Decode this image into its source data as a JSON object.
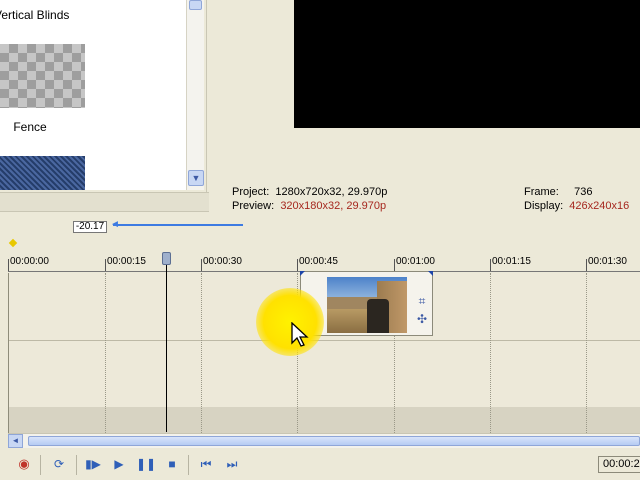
{
  "transitions": {
    "top_item_label": "Vertical Blinds",
    "fence_label": "Fence"
  },
  "preview_info": {
    "project_label": "Project:",
    "project_value": "1280x720x32, 29.970p",
    "preview_label": "Preview:",
    "preview_value": "320x180x32, 29.970p",
    "frame_label": "Frame:",
    "frame_value": "736",
    "display_label": "Display:",
    "display_value": "426x240x16"
  },
  "timeline": {
    "cursor_offset": "-20.17",
    "ruler": [
      "00:00:00",
      "00:00:15",
      "00:00:30",
      "00:00:45",
      "00:01:00",
      "00:01:15",
      "00:01:30"
    ]
  },
  "transport": {
    "timecode": "00:00:2"
  },
  "colors": {
    "accent_blue": "#3d7be2",
    "highlight_yellow": "#ffe100",
    "preview_red": "#a6281f"
  }
}
